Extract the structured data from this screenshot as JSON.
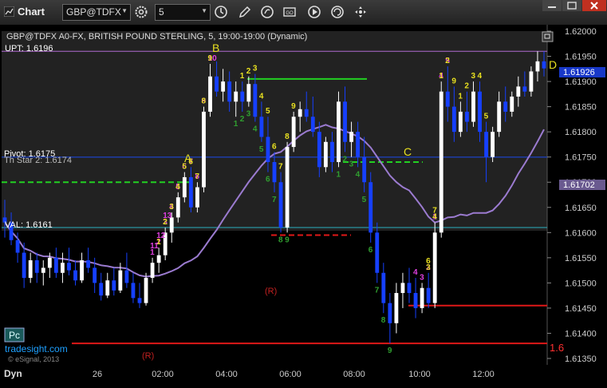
{
  "app": {
    "title": "Chart",
    "symbol": "GBP@TDFX",
    "interval": "5"
  },
  "chart_header": {
    "description": "GBP@TDFX A0-FX, BRITISH POUND STERLING, 5, 19:00-19:00 (Dynamic)",
    "upt_label": "UPT: 1.6196",
    "pivot_label": "Pivot: 1.6175",
    "th_star_label": "Th Star 2: 1.6174",
    "val_label": "VAL: 1.6161"
  },
  "price_axis": {
    "ticks": [
      "1.62000",
      "1.61950",
      "1.61900",
      "1.61850",
      "1.61800",
      "1.61750",
      "1.61700",
      "1.61650",
      "1.61600",
      "1.61550",
      "1.61500",
      "1.61450",
      "1.61400",
      "1.61350"
    ],
    "last_price": "1.61926",
    "ma_price": "1.61702"
  },
  "time_axis": {
    "ticks": [
      "26",
      "02:00",
      "04:00",
      "06:00",
      "08:00",
      "10:00",
      "12:00"
    ],
    "dyn_label": "Dyn"
  },
  "annotations": {
    "wave_labels": [
      "A",
      "B",
      "C",
      "D"
    ],
    "r_labels": [
      "(R)",
      "(R)"
    ],
    "pc_label": "Pc",
    "site": "tradesight.com",
    "copyright": "© eSignal, 2013",
    "edge_price": "1.6"
  },
  "setup_counts": {
    "magenta": [
      "13",
      "12",
      "11",
      "10",
      "9",
      "8",
      "7",
      "6",
      "5",
      "4",
      "3",
      "2",
      "1",
      "4",
      "3",
      "2",
      "1",
      "4",
      "5"
    ],
    "yellow": [
      "9",
      "8",
      "7",
      "6",
      "5",
      "4",
      "3",
      "2",
      "1",
      "9",
      "8",
      "7",
      "6",
      "5",
      "4",
      "3",
      "2",
      "1",
      "7",
      "6",
      "5",
      "4",
      "3",
      "2",
      "1",
      "9",
      "2",
      "1",
      "4",
      "3"
    ],
    "green": [
      "9",
      "8",
      "7",
      "6",
      "5",
      "4",
      "3",
      "2",
      "1",
      "9",
      "8",
      "7",
      "6",
      "5",
      "4",
      "3",
      "2",
      "1"
    ]
  },
  "colors": {
    "upt": "#b06ad0",
    "pivot": "#1d3ca8",
    "value_area": "#2ab0c0",
    "support_green": "#22d022",
    "resistance_red": "#e01818",
    "ma": "#9b7bd0",
    "up_bar": "#ffffff",
    "down_bar": "#1640ff"
  },
  "chart_data": {
    "type": "candlestick",
    "ylim": [
      1.6135,
      1.6205
    ],
    "bars": [
      {
        "o": 1.6163,
        "h": 1.61665,
        "l": 1.6159,
        "c": 1.6162
      },
      {
        "o": 1.6162,
        "h": 1.6164,
        "l": 1.61575,
        "c": 1.61585
      },
      {
        "o": 1.61585,
        "h": 1.616,
        "l": 1.6154,
        "c": 1.6156
      },
      {
        "o": 1.6156,
        "h": 1.6158,
        "l": 1.6149,
        "c": 1.6151
      },
      {
        "o": 1.6151,
        "h": 1.6156,
        "l": 1.615,
        "c": 1.61545
      },
      {
        "o": 1.61545,
        "h": 1.6156,
        "l": 1.615,
        "c": 1.6152
      },
      {
        "o": 1.6152,
        "h": 1.61545,
        "l": 1.61495,
        "c": 1.6153
      },
      {
        "o": 1.6153,
        "h": 1.6156,
        "l": 1.6151,
        "c": 1.6155
      },
      {
        "o": 1.6155,
        "h": 1.6157,
        "l": 1.6151,
        "c": 1.6152
      },
      {
        "o": 1.6152,
        "h": 1.6156,
        "l": 1.615,
        "c": 1.6154
      },
      {
        "o": 1.6154,
        "h": 1.6157,
        "l": 1.61515,
        "c": 1.61525
      },
      {
        "o": 1.61525,
        "h": 1.61545,
        "l": 1.61495,
        "c": 1.61505
      },
      {
        "o": 1.61505,
        "h": 1.6156,
        "l": 1.615,
        "c": 1.61545
      },
      {
        "o": 1.61545,
        "h": 1.6157,
        "l": 1.6152,
        "c": 1.6153
      },
      {
        "o": 1.6153,
        "h": 1.6155,
        "l": 1.6148,
        "c": 1.615
      },
      {
        "o": 1.615,
        "h": 1.6152,
        "l": 1.61465,
        "c": 1.61475
      },
      {
        "o": 1.61475,
        "h": 1.6152,
        "l": 1.6147,
        "c": 1.61505
      },
      {
        "o": 1.61505,
        "h": 1.6153,
        "l": 1.61475,
        "c": 1.61485
      },
      {
        "o": 1.61485,
        "h": 1.6154,
        "l": 1.6148,
        "c": 1.61525
      },
      {
        "o": 1.61525,
        "h": 1.6156,
        "l": 1.6149,
        "c": 1.615
      },
      {
        "o": 1.615,
        "h": 1.6152,
        "l": 1.6146,
        "c": 1.6147
      },
      {
        "o": 1.6147,
        "h": 1.615,
        "l": 1.6145,
        "c": 1.6146
      },
      {
        "o": 1.6146,
        "h": 1.6152,
        "l": 1.61455,
        "c": 1.6151
      },
      {
        "o": 1.6151,
        "h": 1.6155,
        "l": 1.615,
        "c": 1.6154
      },
      {
        "o": 1.6154,
        "h": 1.6157,
        "l": 1.6152,
        "c": 1.61555
      },
      {
        "o": 1.61555,
        "h": 1.6161,
        "l": 1.61545,
        "c": 1.616
      },
      {
        "o": 1.616,
        "h": 1.6164,
        "l": 1.6158,
        "c": 1.6163
      },
      {
        "o": 1.6163,
        "h": 1.6168,
        "l": 1.6162,
        "c": 1.6167
      },
      {
        "o": 1.6167,
        "h": 1.6172,
        "l": 1.6166,
        "c": 1.6171
      },
      {
        "o": 1.6171,
        "h": 1.6173,
        "l": 1.6164,
        "c": 1.6165
      },
      {
        "o": 1.6165,
        "h": 1.617,
        "l": 1.6164,
        "c": 1.6169
      },
      {
        "o": 1.6169,
        "h": 1.6185,
        "l": 1.6168,
        "c": 1.6184
      },
      {
        "o": 1.6184,
        "h": 1.61935,
        "l": 1.6183,
        "c": 1.6191
      },
      {
        "o": 1.6191,
        "h": 1.6194,
        "l": 1.6187,
        "c": 1.6188
      },
      {
        "o": 1.6188,
        "h": 1.61925,
        "l": 1.6186,
        "c": 1.619
      },
      {
        "o": 1.619,
        "h": 1.6192,
        "l": 1.6184,
        "c": 1.6186
      },
      {
        "o": 1.6186,
        "h": 1.619,
        "l": 1.6183,
        "c": 1.6188
      },
      {
        "o": 1.6188,
        "h": 1.619,
        "l": 1.6184,
        "c": 1.6186
      },
      {
        "o": 1.6186,
        "h": 1.6191,
        "l": 1.6185,
        "c": 1.61895
      },
      {
        "o": 1.61895,
        "h": 1.61915,
        "l": 1.6182,
        "c": 1.6183
      },
      {
        "o": 1.6183,
        "h": 1.6186,
        "l": 1.6178,
        "c": 1.6179
      },
      {
        "o": 1.6179,
        "h": 1.6183,
        "l": 1.6172,
        "c": 1.6174
      },
      {
        "o": 1.6174,
        "h": 1.6176,
        "l": 1.6168,
        "c": 1.617
      },
      {
        "o": 1.617,
        "h": 1.6172,
        "l": 1.616,
        "c": 1.6161
      },
      {
        "o": 1.6161,
        "h": 1.6178,
        "l": 1.616,
        "c": 1.6177
      },
      {
        "o": 1.6177,
        "h": 1.6184,
        "l": 1.6176,
        "c": 1.6183
      },
      {
        "o": 1.6183,
        "h": 1.6186,
        "l": 1.618,
        "c": 1.61845
      },
      {
        "o": 1.61845,
        "h": 1.6188,
        "l": 1.6182,
        "c": 1.6183
      },
      {
        "o": 1.6183,
        "h": 1.6187,
        "l": 1.6179,
        "c": 1.618
      },
      {
        "o": 1.618,
        "h": 1.6182,
        "l": 1.6171,
        "c": 1.6173
      },
      {
        "o": 1.6173,
        "h": 1.6179,
        "l": 1.6172,
        "c": 1.6178
      },
      {
        "o": 1.6178,
        "h": 1.618,
        "l": 1.6172,
        "c": 1.6174
      },
      {
        "o": 1.6174,
        "h": 1.6188,
        "l": 1.6173,
        "c": 1.6186
      },
      {
        "o": 1.6186,
        "h": 1.6189,
        "l": 1.6176,
        "c": 1.6178
      },
      {
        "o": 1.6178,
        "h": 1.6182,
        "l": 1.6175,
        "c": 1.618
      },
      {
        "o": 1.618,
        "h": 1.6182,
        "l": 1.6173,
        "c": 1.6175
      },
      {
        "o": 1.6175,
        "h": 1.6179,
        "l": 1.6168,
        "c": 1.617
      },
      {
        "o": 1.617,
        "h": 1.6172,
        "l": 1.6158,
        "c": 1.616
      },
      {
        "o": 1.616,
        "h": 1.6162,
        "l": 1.615,
        "c": 1.6152
      },
      {
        "o": 1.6152,
        "h": 1.6154,
        "l": 1.6144,
        "c": 1.6146
      },
      {
        "o": 1.6146,
        "h": 1.6148,
        "l": 1.6138,
        "c": 1.6142
      },
      {
        "o": 1.6142,
        "h": 1.615,
        "l": 1.614,
        "c": 1.6148
      },
      {
        "o": 1.6148,
        "h": 1.6152,
        "l": 1.6145,
        "c": 1.615
      },
      {
        "o": 1.615,
        "h": 1.6153,
        "l": 1.6146,
        "c": 1.6148
      },
      {
        "o": 1.6148,
        "h": 1.6151,
        "l": 1.6143,
        "c": 1.6145
      },
      {
        "o": 1.6145,
        "h": 1.615,
        "l": 1.6144,
        "c": 1.6149
      },
      {
        "o": 1.6149,
        "h": 1.6152,
        "l": 1.6145,
        "c": 1.6146
      },
      {
        "o": 1.6146,
        "h": 1.6162,
        "l": 1.6145,
        "c": 1.616
      },
      {
        "o": 1.616,
        "h": 1.619,
        "l": 1.6159,
        "c": 1.6188
      },
      {
        "o": 1.6188,
        "h": 1.6193,
        "l": 1.6182,
        "c": 1.6185
      },
      {
        "o": 1.6185,
        "h": 1.6189,
        "l": 1.6178,
        "c": 1.618
      },
      {
        "o": 1.618,
        "h": 1.6186,
        "l": 1.6179,
        "c": 1.6184
      },
      {
        "o": 1.6184,
        "h": 1.6188,
        "l": 1.618,
        "c": 1.6182
      },
      {
        "o": 1.6182,
        "h": 1.619,
        "l": 1.6181,
        "c": 1.6188
      },
      {
        "o": 1.6188,
        "h": 1.619,
        "l": 1.6178,
        "c": 1.618
      },
      {
        "o": 1.618,
        "h": 1.6182,
        "l": 1.617,
        "c": 1.6175
      },
      {
        "o": 1.6175,
        "h": 1.6181,
        "l": 1.6174,
        "c": 1.618
      },
      {
        "o": 1.618,
        "h": 1.6188,
        "l": 1.6179,
        "c": 1.6186
      },
      {
        "o": 1.6186,
        "h": 1.6189,
        "l": 1.6182,
        "c": 1.6184
      },
      {
        "o": 1.6184,
        "h": 1.6188,
        "l": 1.6183,
        "c": 1.6187
      },
      {
        "o": 1.6187,
        "h": 1.6191,
        "l": 1.6185,
        "c": 1.6189
      },
      {
        "o": 1.6189,
        "h": 1.6192,
        "l": 1.6187,
        "c": 1.6188
      },
      {
        "o": 1.6188,
        "h": 1.6193,
        "l": 1.6187,
        "c": 1.6192
      },
      {
        "o": 1.6192,
        "h": 1.6196,
        "l": 1.619,
        "c": 1.6194
      },
      {
        "o": 1.6194,
        "h": 1.6196,
        "l": 1.6191,
        "c": 1.61926
      }
    ],
    "levels": [
      {
        "name": "UPT",
        "price": 1.6196
      },
      {
        "name": "Pivot",
        "price": 1.6175
      },
      {
        "name": "VAL",
        "price": 1.6161
      },
      {
        "name": "red-low",
        "price": 1.6138
      }
    ]
  }
}
